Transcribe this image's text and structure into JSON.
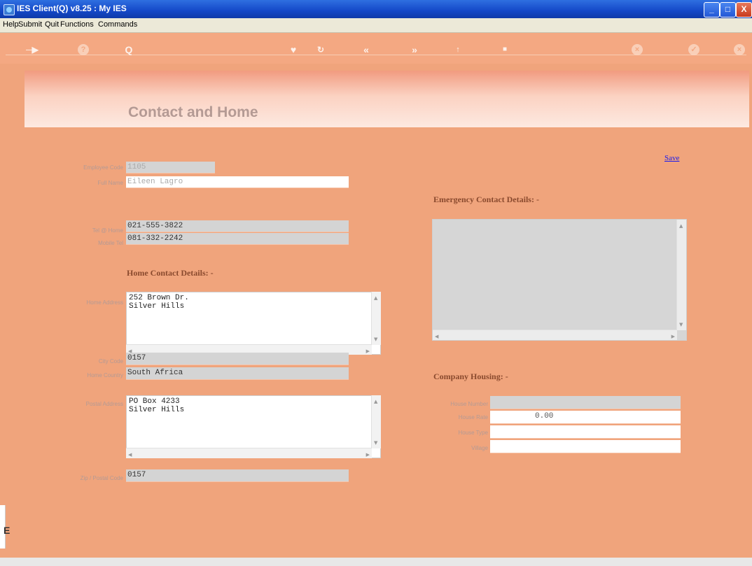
{
  "window": {
    "title": "IES Client(Q) v8.25 : My IES",
    "controls": {
      "minimize": "_",
      "maximize": "□",
      "close": "X"
    }
  },
  "menu": [
    "Help",
    "Submit",
    "Quit",
    "Functions",
    "Commands"
  ],
  "toolbar": {
    "icons": [
      "arrow-right-icon",
      "help-icon",
      "search-icon",
      "heart-icon",
      "refresh-icon",
      "rewind-icon",
      "fast-forward-icon",
      "up-icon",
      "stop-icon",
      "cancel-icon",
      "check-icon",
      "close-icon"
    ],
    "glyphs": {
      "help": "?",
      "search": "Q",
      "rewind": "«",
      "forward": "»",
      "cancel": "×",
      "check": "✓",
      "close": "×"
    }
  },
  "page": {
    "title": "Contact and Home",
    "save_label": "Save"
  },
  "employee": {
    "code_label": "Employee Code",
    "code_value": "1105",
    "full_name_label": "Full Name",
    "full_name_value": "Eileen Lagro",
    "tel_home_label": "Tel @ Home",
    "tel_home_value": "021-555-3822",
    "mobile_label": "Mobile Tel",
    "mobile_value": "081-332-2242"
  },
  "home": {
    "section_title": "Home Contact Details: -",
    "address_label": "Home Address",
    "address_lines": "252 Brown Dr.\nSilver Hills",
    "city_code_label": "City Code",
    "city_code_value": "0157",
    "country_label": "Home Country",
    "country_value": "South Africa",
    "postal_label": "Postal Address",
    "postal_lines": "PO Box 4233\nSilver Hills",
    "zip_label": "Zip / Postal Code",
    "zip_value": "0157"
  },
  "emergency": {
    "section_title": "Emergency Contact Details: -"
  },
  "housing": {
    "section_title": "Company Housing: -",
    "house_number_label": "House Number",
    "house_number_value": "",
    "house_rate_label": "House Rate",
    "house_rate_value": "0.00",
    "house_type_label": "House Type",
    "house_type_value": "",
    "village_label": "Village",
    "village_value": ""
  },
  "side": {
    "letter": "E"
  }
}
